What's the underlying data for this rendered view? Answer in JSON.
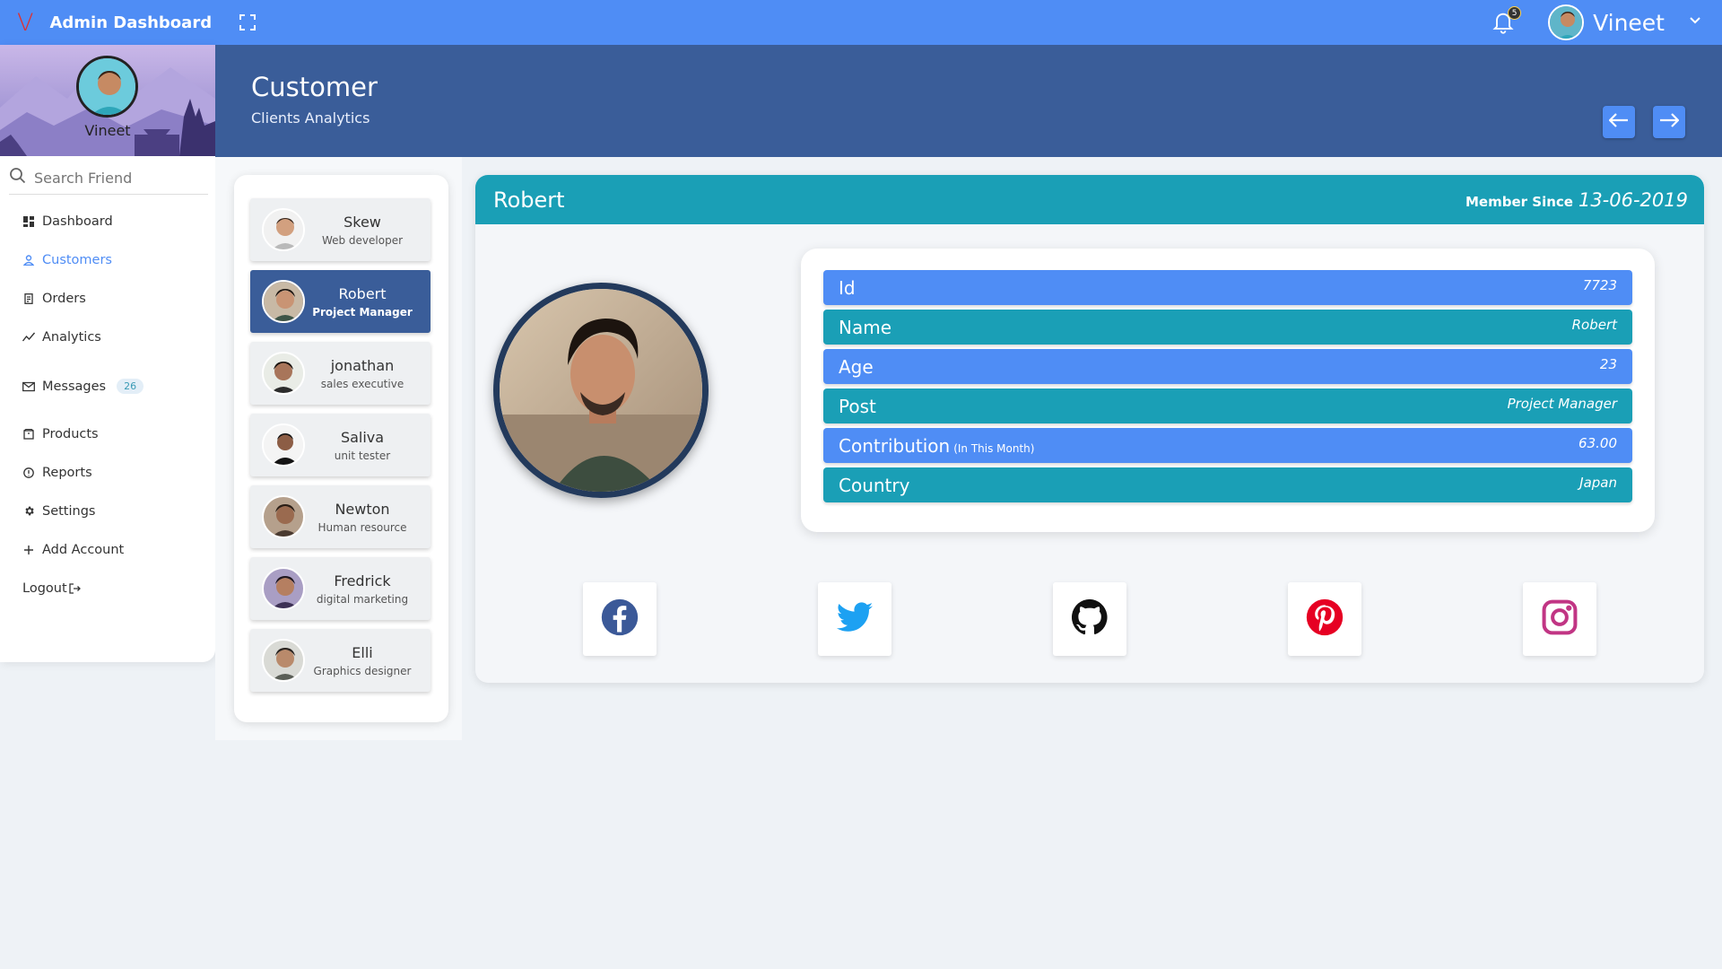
{
  "topbar": {
    "logo": "V",
    "title": "Admin Dashboard",
    "notification_count": "5",
    "user_name": "Vineet"
  },
  "sidebar": {
    "profile_name": "Vineet",
    "search_placeholder": "Search Friend",
    "items": [
      {
        "label": "Dashboard",
        "icon": "grid-icon"
      },
      {
        "label": "Customers",
        "icon": "user-icon",
        "active": true
      },
      {
        "label": "Orders",
        "icon": "receipt-icon"
      },
      {
        "label": "Analytics",
        "icon": "trend-icon"
      },
      {
        "label": "Messages",
        "icon": "mail-icon",
        "badge": "26"
      },
      {
        "label": "Products",
        "icon": "box-icon"
      },
      {
        "label": "Reports",
        "icon": "info-icon"
      },
      {
        "label": "Settings",
        "icon": "gear-icon"
      },
      {
        "label": "Add Account",
        "icon": "plus-icon"
      },
      {
        "label": "Logout",
        "icon": "logout-icon"
      }
    ]
  },
  "header": {
    "title": "Customer",
    "subtitle": "Clients Analytics"
  },
  "friends": [
    {
      "name": "Skew",
      "role": "Web developer"
    },
    {
      "name": "Robert",
      "role": "Project Manager",
      "active": true
    },
    {
      "name": "jonathan",
      "role": "sales executive"
    },
    {
      "name": "Saliva",
      "role": "unit tester"
    },
    {
      "name": "Newton",
      "role": "Human resource"
    },
    {
      "name": "Fredrick",
      "role": "digital marketing"
    },
    {
      "name": "Elli",
      "role": "Graphics designer"
    }
  ],
  "detail": {
    "name": "Robert",
    "member_since_label": "Member Since",
    "member_since_date": "13-06-2019",
    "rows": [
      {
        "key": "Id",
        "value": "7723"
      },
      {
        "key": "Name",
        "value": "Robert"
      },
      {
        "key": "Age",
        "value": "23"
      },
      {
        "key": "Post",
        "value": "Project Manager"
      },
      {
        "key": "Contribution",
        "key_note": "(In This Month)",
        "value": "63.00"
      },
      {
        "key": "Country",
        "value": "Japan"
      }
    ],
    "socials": [
      "facebook-icon",
      "twitter-icon",
      "github-icon",
      "pinterest-icon",
      "instagram-icon"
    ]
  },
  "colors": {
    "topbar": "#4f8df5",
    "header_band": "#3a5d99",
    "teal": "#1a9fb6",
    "active_friend": "#3a5d99",
    "facebook": "#3b5998",
    "twitter": "#1da1f2",
    "pinterest": "#e60023",
    "instagram": "#c13584"
  }
}
